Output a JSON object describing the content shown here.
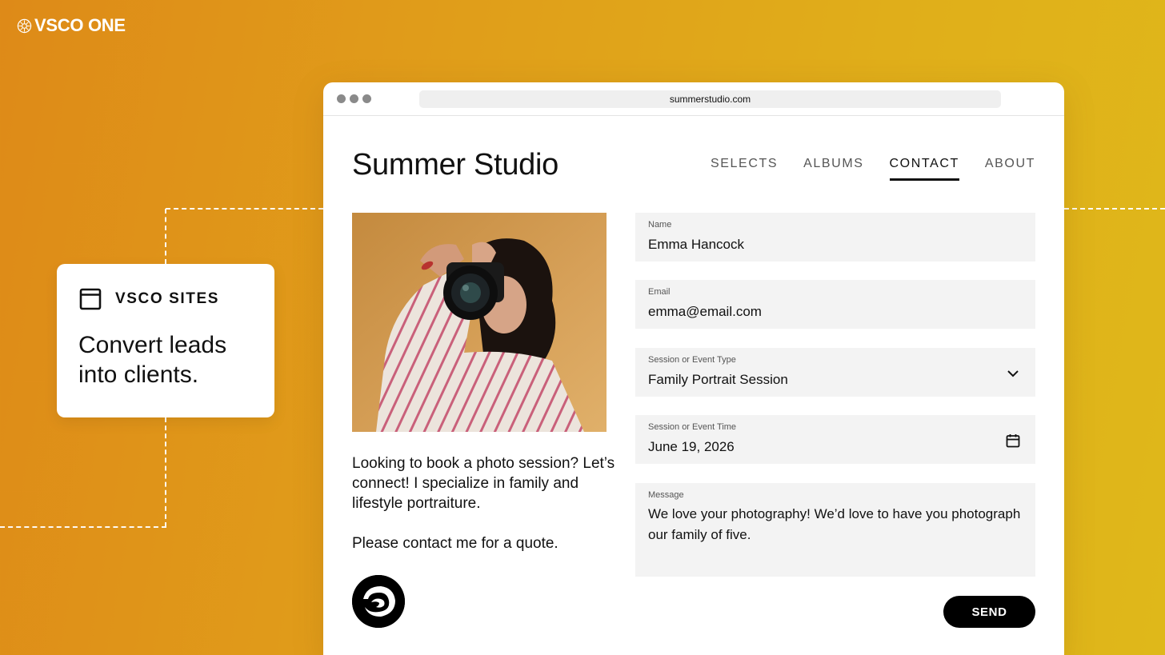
{
  "brand": {
    "name": "VSCO ONE"
  },
  "feature_card": {
    "title": "VSCO SITES",
    "description": "Convert leads into clients.",
    "icon": "browser-window-icon"
  },
  "browser": {
    "url": "summerstudio.com"
  },
  "site": {
    "title": "Summer Studio",
    "nav": [
      {
        "label": "SELECTS",
        "active": false
      },
      {
        "label": "ALBUMS",
        "active": false
      },
      {
        "label": "CONTACT",
        "active": true
      },
      {
        "label": "ABOUT",
        "active": false
      }
    ],
    "bio": {
      "paragraph1": "Looking to book a photo session? Let’s connect! I specialize in family and lifestyle portraiture.",
      "paragraph2": "Please contact me for a quote."
    }
  },
  "form": {
    "name": {
      "label": "Name",
      "value": "Emma Hancock"
    },
    "email": {
      "label": "Email",
      "value": "emma@email.com"
    },
    "session_type": {
      "label": "Session or Event Type",
      "value": "Family Portrait Session"
    },
    "session_time": {
      "label": "Session or Event Time",
      "value": "June 19, 2026"
    },
    "message": {
      "label": "Message",
      "value": "We love your photography! We’d love to have you photograph our family of five."
    },
    "send_label": "SEND"
  },
  "colors": {
    "background_start": "#de8a18",
    "background_end": "#dfb81a",
    "field_bg": "#f3f3f3",
    "button_bg": "#000000"
  }
}
